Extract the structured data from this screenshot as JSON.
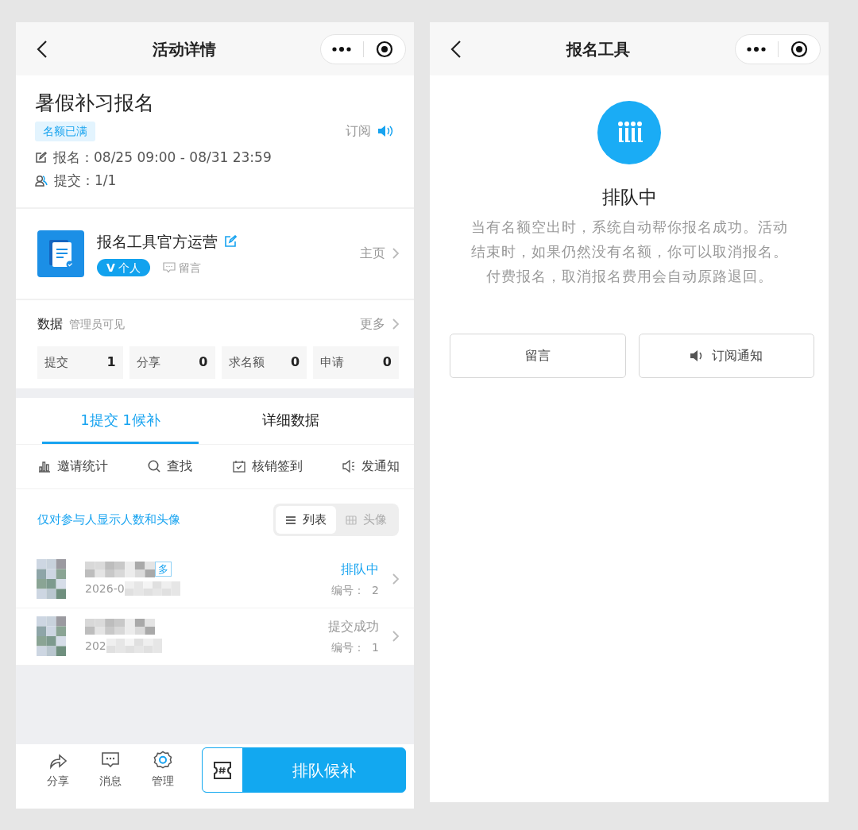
{
  "activity_page": {
    "nav_title": "活动详情",
    "activity": {
      "title": "暑假补习报名",
      "status_tag": "名额已满",
      "subscribe_label": "订阅",
      "signup_time": "报名：08/25 09:00 - 08/31 23:59",
      "submit_count": "提交：1/1"
    },
    "organizer": {
      "name": "报名工具官方运营",
      "badge": "**V** 个人",
      "message_label": "留言",
      "homepage_label": "主页"
    },
    "data": {
      "title": "数据",
      "note": "管理员可见",
      "more_label": "更多",
      "stats": [
        {
          "label": "提交",
          "value": "1"
        },
        {
          "label": "分享",
          "value": "0"
        },
        {
          "label": "求名额",
          "value": "0"
        },
        {
          "label": "申请",
          "value": "0"
        }
      ]
    },
    "tabs": [
      {
        "label": "1提交 1候补",
        "selected": true
      },
      {
        "label": "详细数据",
        "selected": false
      }
    ],
    "tools": [
      {
        "label": "邀请统计"
      },
      {
        "label": "查找"
      },
      {
        "label": "核销签到"
      },
      {
        "label": "发通知"
      }
    ],
    "notice": "仅对参与人显示人数和头像",
    "view_toggle": [
      {
        "label": "列表",
        "selected": true
      },
      {
        "label": "头像",
        "selected": false
      }
    ],
    "participants": [
      {
        "tag": "多",
        "date": "2026-0",
        "status": "排队中",
        "waiting": true,
        "number": "编号：  2"
      },
      {
        "date": "202",
        "status": "提交成功",
        "waiting": false,
        "number": "编号：  1"
      }
    ],
    "bottom_actions": [
      {
        "label": "分享"
      },
      {
        "label": "消息"
      },
      {
        "label": "管理"
      }
    ],
    "primary_button": "排队候补"
  },
  "queue_page": {
    "nav_title": "报名工具",
    "status_title": "排队中",
    "description": "当有名额空出时，系统自动帮你报名成功。活动结束时，如果仍然没有名额，你可以取消报名。付费报名，取消报名费用会自动原路退回。",
    "buttons": [
      {
        "label": "留言"
      },
      {
        "label": "订阅通知"
      }
    ]
  }
}
